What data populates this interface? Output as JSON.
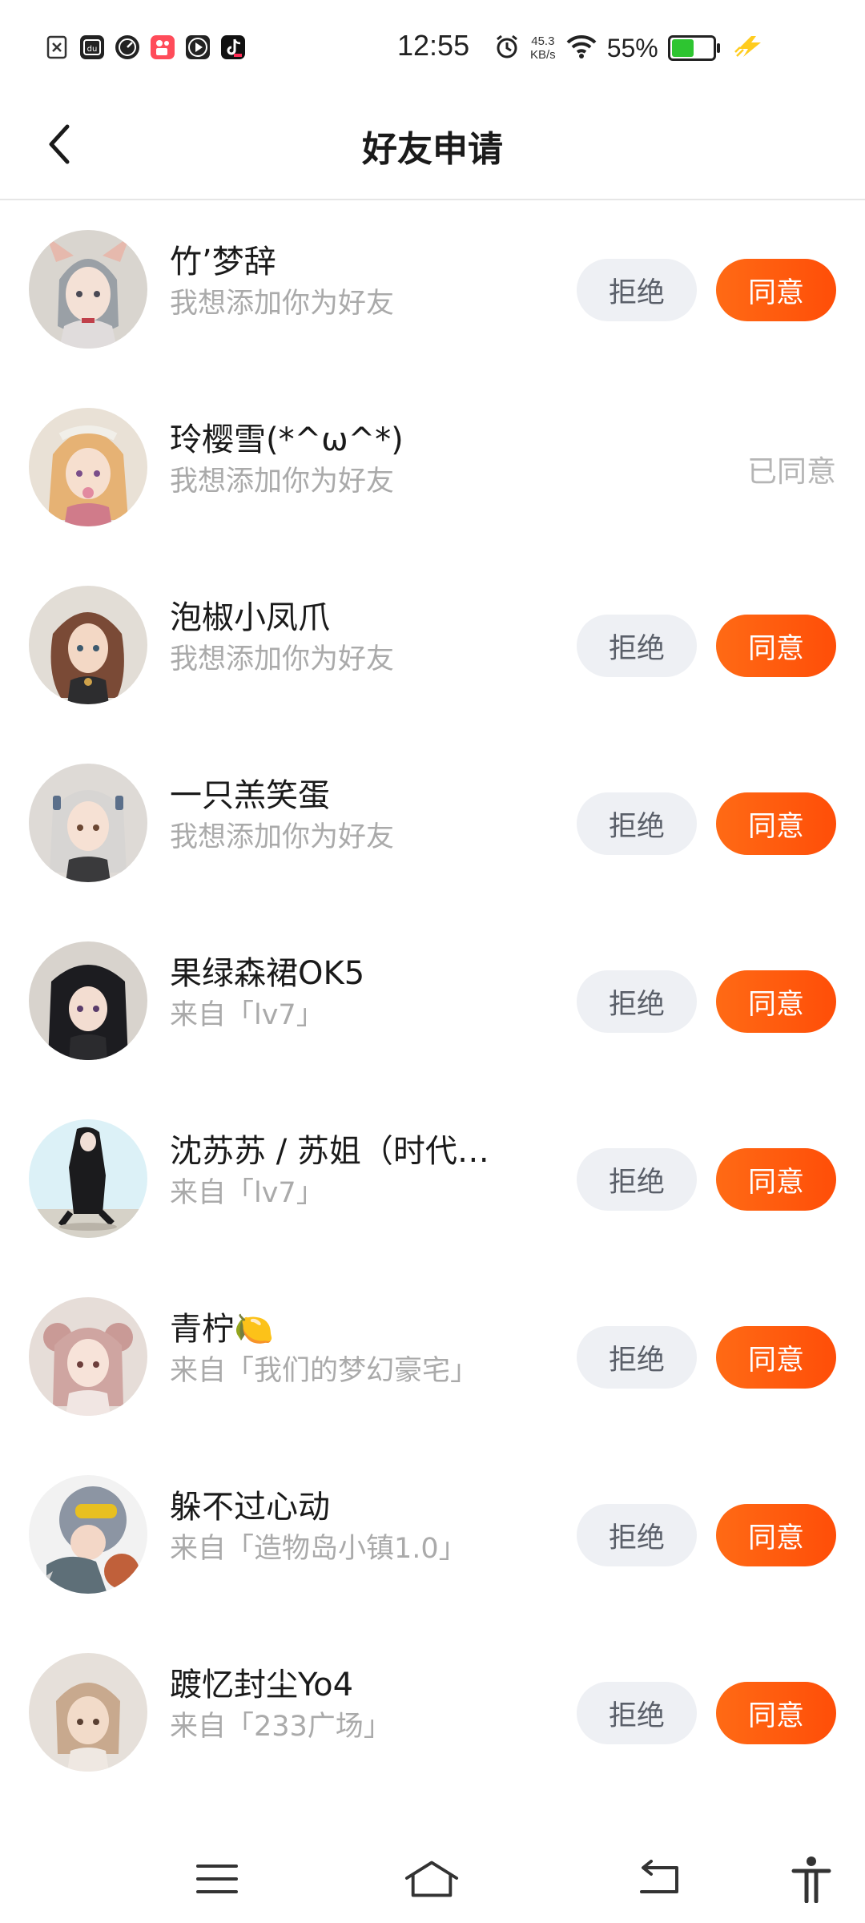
{
  "status_bar": {
    "time": "12:55",
    "net_speed_value": "45.3",
    "net_speed_unit": "KB/s",
    "battery_percent": "55%",
    "battery_level": 0.55,
    "app_icons": [
      "file-x-icon",
      "du-app-icon",
      "speedometer-icon",
      "kuaishou-icon",
      "play-icon",
      "tiktok-icon"
    ],
    "status_icons": [
      "alarm-icon",
      "wifi-icon",
      "battery-icon",
      "charging-icon"
    ]
  },
  "header": {
    "title": "好友申请",
    "back_icon": "chevron-left-icon"
  },
  "actions": {
    "reject_label": "拒绝",
    "accept_label": "同意",
    "accepted_label": "已同意"
  },
  "requests": [
    {
      "name": "竹’梦辞",
      "message": "我想添加你为好友",
      "status": "pending"
    },
    {
      "name": "玲樱雪(*^ω^*)",
      "message": "我想添加你为好友",
      "status": "accepted"
    },
    {
      "name": "泡椒小凤爪",
      "message": "我想添加你为好友",
      "status": "pending"
    },
    {
      "name": "一只羔笑蛋",
      "message": "我想添加你为好友",
      "status": "pending"
    },
    {
      "name": "果绿森裙OK5",
      "message": "来自「lv7」",
      "status": "pending"
    },
    {
      "name": "沈苏苏 / 苏姐（时代…",
      "message": "来自「lv7」",
      "status": "pending"
    },
    {
      "name": "青柠🍋",
      "message": "来自「我们的梦幻豪宅」",
      "status": "pending"
    },
    {
      "name": "躲不过心动",
      "message": "来自「造物岛小镇1.0」",
      "status": "pending"
    },
    {
      "name": "踱忆封尘Yo4",
      "message": "来自「233广场」",
      "status": "pending"
    }
  ],
  "colors": {
    "accent": "#ff5a0d",
    "reject_bg": "#eef0f4",
    "reject_text": "#5a5f69",
    "subtext": "#aaaaaa"
  },
  "nav_bar": {
    "icons": [
      "menu-icon",
      "home-icon",
      "back-icon",
      "accessibility-icon"
    ]
  }
}
